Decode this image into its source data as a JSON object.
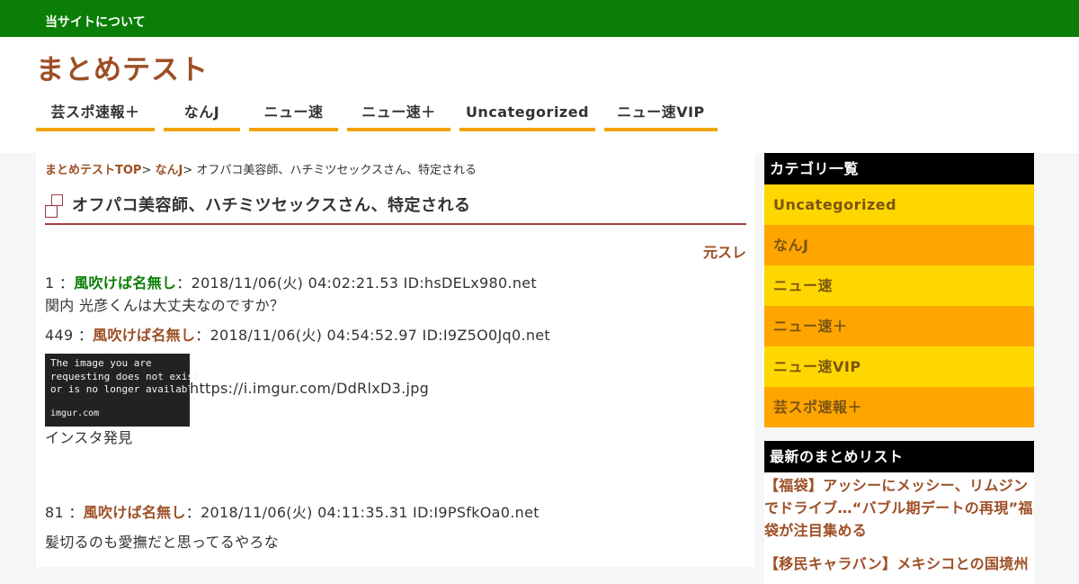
{
  "topbar": {
    "about_link": "当サイトについて"
  },
  "site": {
    "title": "まとめテスト"
  },
  "nav": {
    "items": [
      {
        "label": "芸スポ速報＋"
      },
      {
        "label": "なんJ"
      },
      {
        "label": "ニュー速"
      },
      {
        "label": "ニュー速＋"
      },
      {
        "label": "Uncategorized"
      },
      {
        "label": "ニュー速VIP"
      }
    ]
  },
  "breadcrumb": {
    "home": "まとめテストTOP",
    "sep": ">",
    "category": "なんJ",
    "current": "オフパコ美容師、ハチミツセックスさん、特定される"
  },
  "post": {
    "title": "オフパコ美容師、ハチミツセックスさん、特定される",
    "source_link": "元スレ",
    "responses": [
      {
        "num": "1",
        "sep": "：",
        "name": "風吹けば名無し",
        "meta": "：2018/11/06(火) 04:02:21.53 ID:hsDELx980.net",
        "body": "関内 光彦くんは大丈夫なのですか？"
      },
      {
        "num": "449",
        "sep": "：",
        "name": "風吹けば名無し",
        "meta": "：2018/11/06(火) 04:54:52.97 ID:I9Z5O0Jq0.net",
        "image_text": "The image you are\nrequesting does not exist\nor is no longer available.",
        "image_footer": "imgur.com",
        "image_url": "https://i.imgur.com/DdRlxD3.jpg",
        "body": "インスタ発見"
      },
      {
        "num": "81",
        "sep": "：",
        "name": "風吹けば名無し",
        "meta": "：2018/11/06(火) 04:11:35.31 ID:I9PSfkOa0.net",
        "body": "髪切るのも愛撫だと思ってるやろな"
      }
    ]
  },
  "sidebar": {
    "categories_title": "カテゴリ一覧",
    "categories": [
      {
        "label": "Uncategorized"
      },
      {
        "label": "なんJ"
      },
      {
        "label": "ニュー速"
      },
      {
        "label": "ニュー速＋"
      },
      {
        "label": "ニュー速VIP"
      },
      {
        "label": "芸スポ速報＋"
      }
    ],
    "recent_title": "最新のまとめリスト",
    "recent": [
      {
        "label": "【福袋】アッシーにメッシー、リムジンでドライブ…“バブル期デートの再現”福袋が注目集める"
      },
      {
        "label": "【移民キャラバン】メキシコとの国境州"
      }
    ]
  },
  "colors": {
    "topbar": "#0a7e07",
    "brand": "#9d4f25",
    "nav_underline": "#f0a30a",
    "cat_yellow": "#ffd700",
    "cat_orange": "#ffa500",
    "title_rule": "#a34040"
  }
}
